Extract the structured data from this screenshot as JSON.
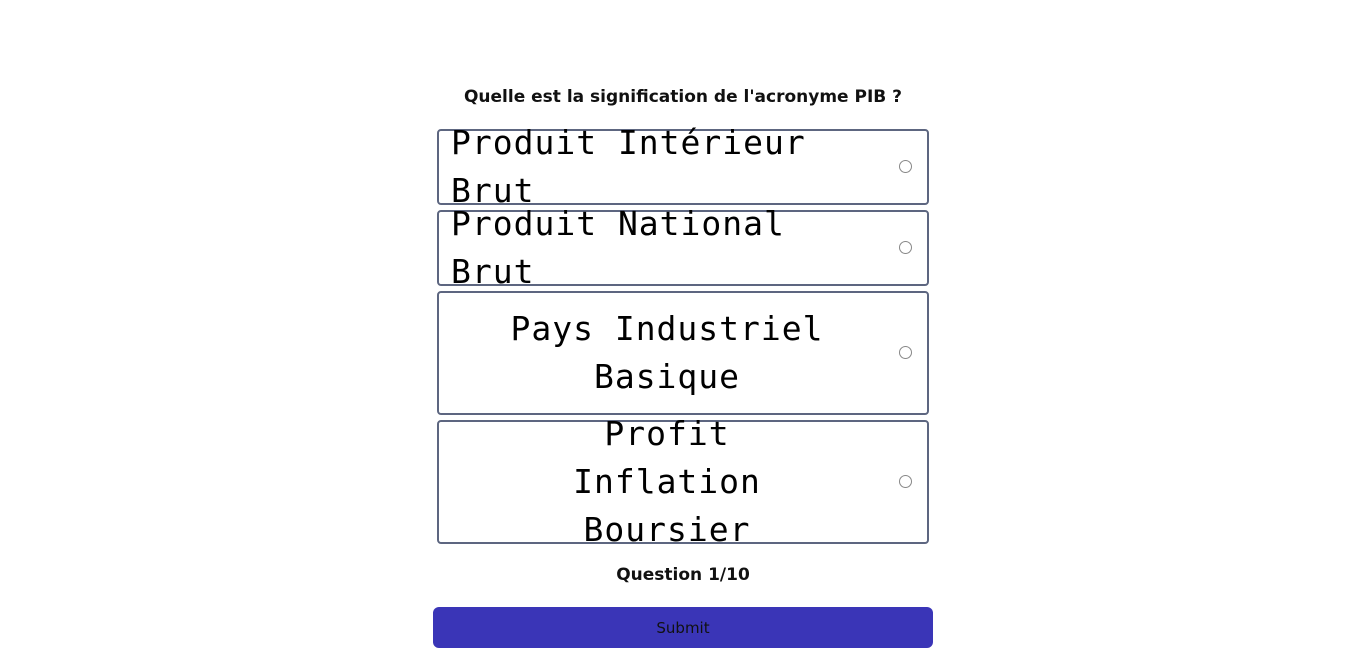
{
  "quiz": {
    "question": "Quelle est la signification de l'acronyme PIB ?",
    "answers": [
      {
        "label": "Produit Intérieur Brut",
        "selected": false
      },
      {
        "label": "Produit National Brut",
        "selected": false
      },
      {
        "label": "Pays Industriel Basique",
        "selected": false
      },
      {
        "label": "Profit Inflation Boursier",
        "selected": false
      }
    ],
    "progress": "Question 1/10",
    "submit_label": "Submit"
  },
  "colors": {
    "submit_background": "#3a35b7",
    "answer_border": "#5d6680",
    "radio_border": "#888888"
  },
  "icons": {
    "answer_radio": "radio-unchecked-icon"
  }
}
